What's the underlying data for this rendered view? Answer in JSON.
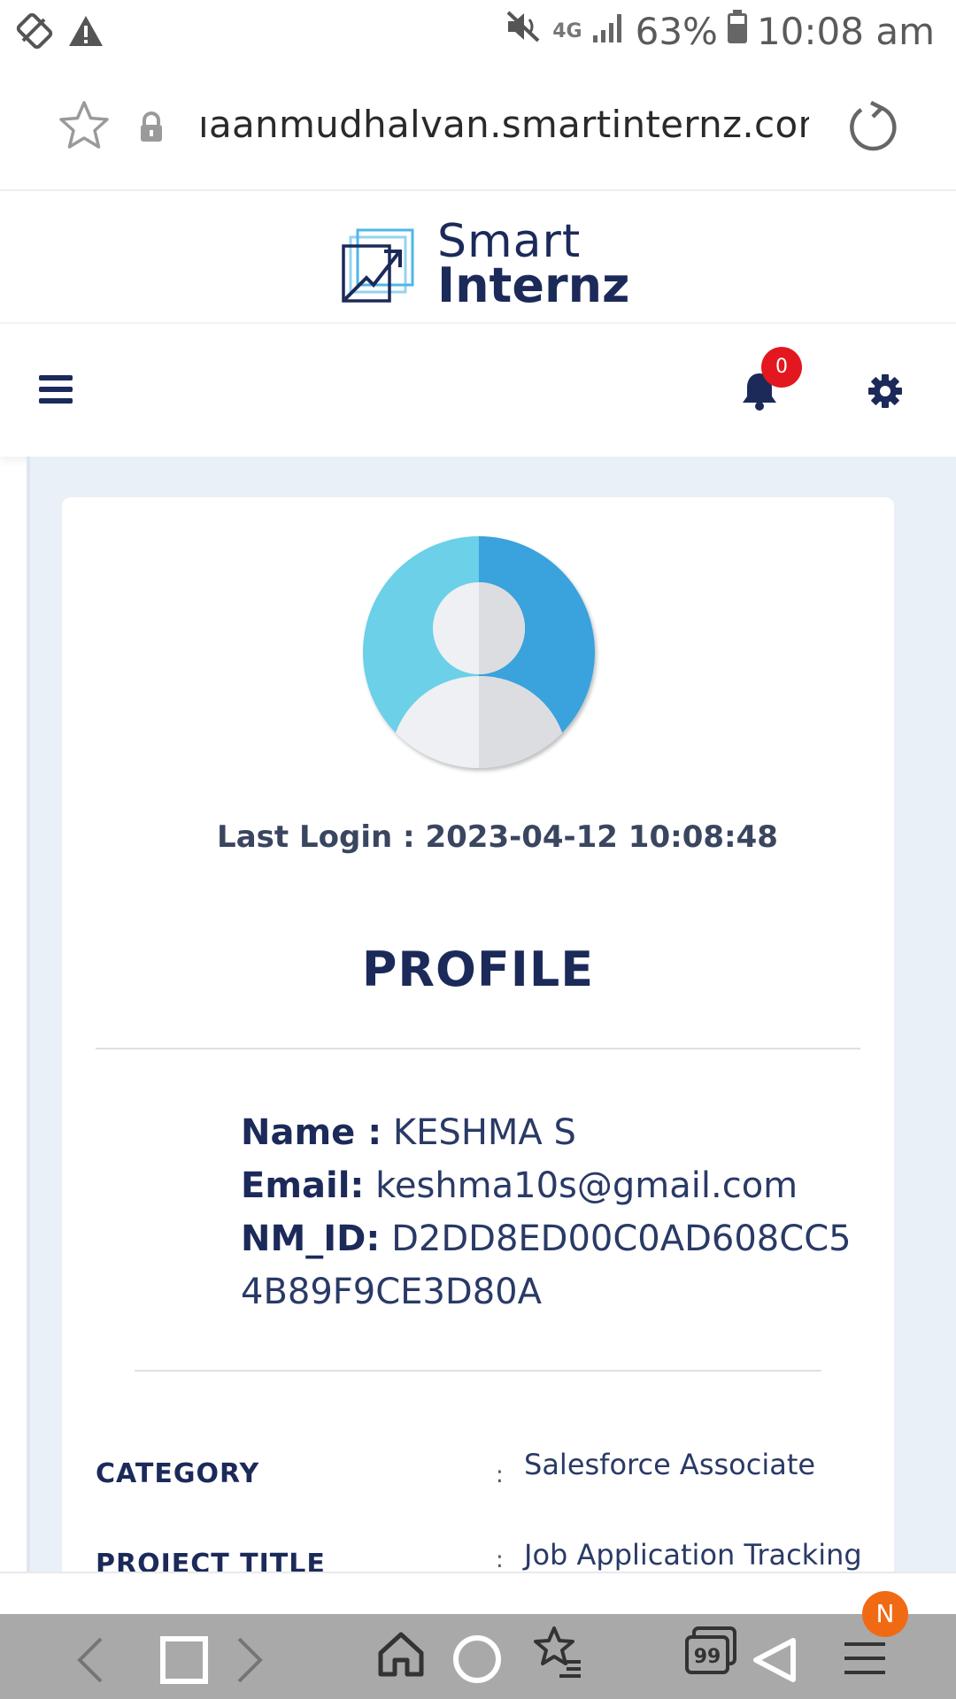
{
  "status_bar": {
    "battery": "63%",
    "time": "10:08 am",
    "network": "4G"
  },
  "address_bar": {
    "url": "ıaanmudhalvan.smartinternz.com"
  },
  "site": {
    "logo_line1": "Smart",
    "logo_line2": "Internz",
    "notification_count": "0"
  },
  "profile": {
    "last_login": "Last Login : 2023-04-12 10:08:48",
    "title": "PROFILE",
    "name_label": "Name :",
    "name_value": "KESHMA S",
    "email_label": "Email:",
    "email_value": "keshma10s@gmail.com",
    "nmid_label": "NM_ID:",
    "nmid_value_line1": "D2DD8ED00C0AD608CC5",
    "nmid_value_line2": "4B89F9CE3D80A",
    "category_label": "CATEGORY",
    "category_value": "Salesforce Associate",
    "project_label": "PROJECT TITLE",
    "project_value": "Job Application Tracking",
    "colon": ":"
  },
  "browser_nav": {
    "n_badge": "N"
  },
  "colors": {
    "brand_navy": "#1c2a5a",
    "badge_red": "#e3171f",
    "content_bg": "#eaf0f7",
    "avatar_light": "#6bd0e8",
    "avatar_dark": "#3aa2dd"
  }
}
